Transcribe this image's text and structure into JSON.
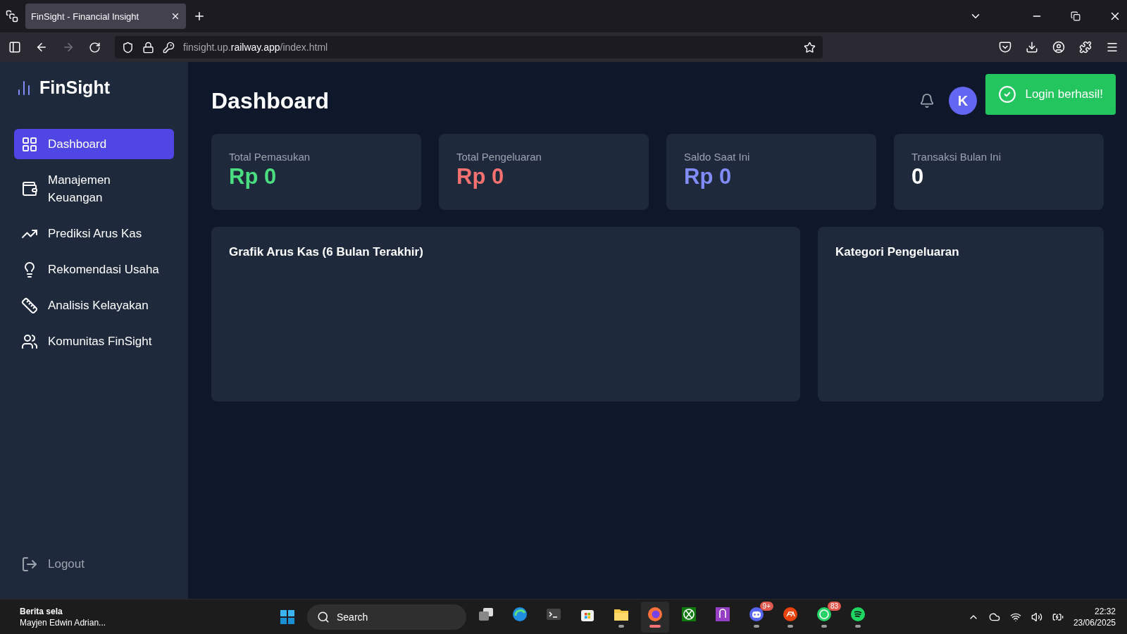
{
  "browser": {
    "tab_title": "FinSight - Financial Insight",
    "url": {
      "prefix": "finsight.up.",
      "domain": "railway.app",
      "path": "/index.html"
    }
  },
  "sidebar": {
    "brand": "FinSight",
    "items": [
      {
        "label": "Dashboard",
        "selected": true
      },
      {
        "label": "Manajemen Keuangan",
        "selected": false
      },
      {
        "label": "Prediksi Arus Kas",
        "selected": false
      },
      {
        "label": "Rekomendasi Usaha",
        "selected": false
      },
      {
        "label": "Analisis Kelayakan",
        "selected": false
      },
      {
        "label": "Komunitas FinSight",
        "selected": false
      }
    ],
    "logout": "Logout"
  },
  "header": {
    "title": "Dashboard",
    "avatar": "K",
    "toast": "Login berhasil!"
  },
  "stats": [
    {
      "label": "Total Pemasukan",
      "value": "Rp 0",
      "color": "#4ade80"
    },
    {
      "label": "Total Pengeluaran",
      "value": "Rp 0",
      "color": "#f87171"
    },
    {
      "label": "Saldo Saat Ini",
      "value": "Rp 0",
      "color": "#818cf8"
    },
    {
      "label": "Transaksi Bulan Ini",
      "value": "0",
      "color": "#ffffff"
    }
  ],
  "panels": [
    {
      "title": "Grafik Arus Kas (6 Bulan Terakhir)"
    },
    {
      "title": "Kategori Pengeluaran"
    }
  ],
  "taskbar": {
    "news": {
      "title": "Berita sela",
      "subtitle": "Mayjen Edwin Adrian..."
    },
    "search": "Search",
    "apps": [
      {
        "kind": "start"
      },
      {
        "kind": "taskview",
        "running": false,
        "active": false
      },
      {
        "kind": "edge",
        "running": false,
        "active": false
      },
      {
        "kind": "terminal",
        "running": false,
        "active": false
      },
      {
        "kind": "store",
        "running": false,
        "active": false
      },
      {
        "kind": "files",
        "running": true,
        "active": false
      },
      {
        "kind": "firefox",
        "running": true,
        "active": true
      },
      {
        "kind": "xbox",
        "running": false,
        "active": false
      },
      {
        "kind": "proton",
        "running": false,
        "active": false
      },
      {
        "kind": "discord",
        "running": true,
        "active": false,
        "badge": "9+"
      },
      {
        "kind": "ea",
        "running": true,
        "active": false
      },
      {
        "kind": "whatsapp",
        "running": true,
        "active": false,
        "badge": "83"
      },
      {
        "kind": "spotify",
        "running": true,
        "active": false
      }
    ],
    "time": "22:32",
    "date": "23/06/2025"
  }
}
